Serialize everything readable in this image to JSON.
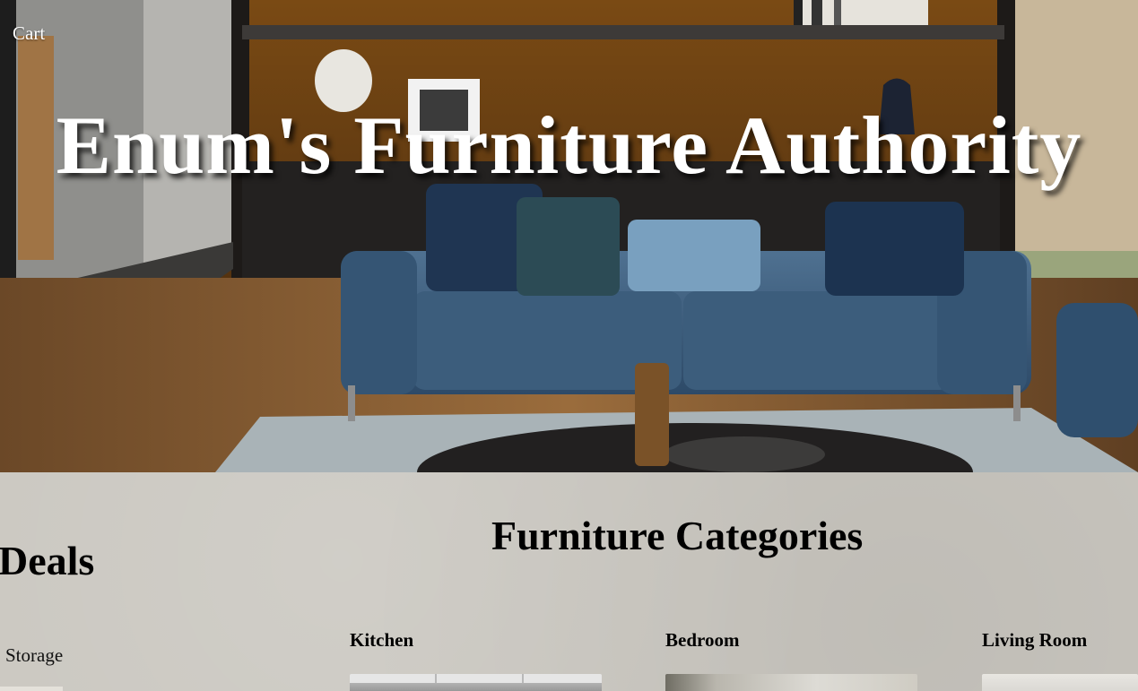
{
  "nav": {
    "cart_label": "Cart"
  },
  "hero": {
    "title": "Enum's Furniture Authority"
  },
  "deals": {
    "heading": "Deals",
    "items": [
      {
        "label": "Storage"
      }
    ]
  },
  "categories": {
    "heading": "Furniture Categories",
    "items": [
      {
        "name": "Kitchen"
      },
      {
        "name": "Bedroom"
      },
      {
        "name": "Living Room"
      }
    ]
  }
}
